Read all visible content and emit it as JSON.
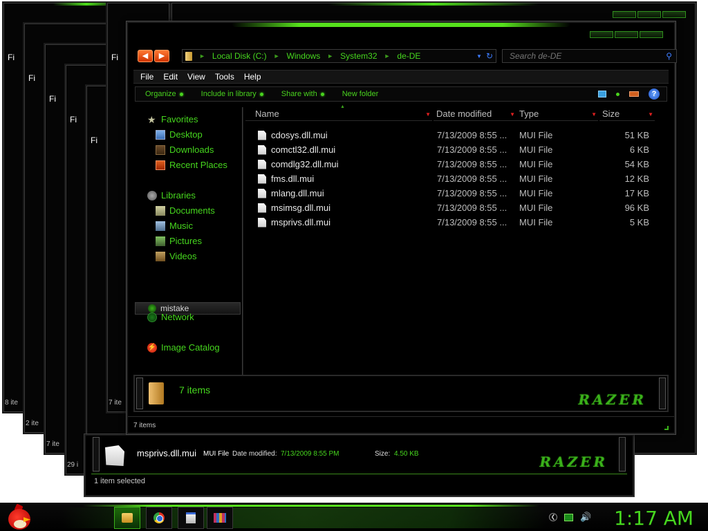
{
  "background_windows": [
    {
      "menu": "Fi",
      "count": "8 ite"
    },
    {
      "menu": "Fi",
      "count": "2 ite"
    },
    {
      "menu": "Fi",
      "count": "7 ite"
    },
    {
      "menu": "Fi",
      "count": "29 i"
    },
    {
      "menu": "Fi",
      "count": ""
    },
    {
      "menu": "Fi",
      "count": "7 ite"
    }
  ],
  "main_window": {
    "breadcrumb": [
      "Local Disk (C:)",
      "Windows",
      "System32",
      "de-DE"
    ],
    "search_placeholder": "Search de-DE",
    "menu": [
      "File",
      "Edit",
      "View",
      "Tools",
      "Help"
    ],
    "commands": [
      "Organize",
      "Include in library",
      "Share with",
      "New folder"
    ],
    "nav": {
      "favorites_label": "Favorites",
      "favorites": [
        "Desktop",
        "Downloads",
        "Recent Places"
      ],
      "libraries_label": "Libraries",
      "libraries": [
        "Documents",
        "Music",
        "Pictures",
        "Videos"
      ],
      "computer": "mistake",
      "network": "Network",
      "image_catalog": "Image Catalog"
    },
    "columns": [
      "Name",
      "Date modified",
      "Type",
      "Size"
    ],
    "files": [
      {
        "name": "cdosys.dll.mui",
        "date": "7/13/2009 8:55 ...",
        "type": "MUI File",
        "size": "51 KB"
      },
      {
        "name": "comctl32.dll.mui",
        "date": "7/13/2009 8:55 ...",
        "type": "MUI File",
        "size": "6 KB"
      },
      {
        "name": "comdlg32.dll.mui",
        "date": "7/13/2009 8:55 ...",
        "type": "MUI File",
        "size": "54 KB"
      },
      {
        "name": "fms.dll.mui",
        "date": "7/13/2009 8:55 ...",
        "type": "MUI File",
        "size": "12 KB"
      },
      {
        "name": "mlang.dll.mui",
        "date": "7/13/2009 8:55 ...",
        "type": "MUI File",
        "size": "17 KB"
      },
      {
        "name": "msimsg.dll.mui",
        "date": "7/13/2009 8:55 ...",
        "type": "MUI File",
        "size": "96 KB"
      },
      {
        "name": "msprivs.dll.mui",
        "date": "7/13/2009 8:55 ...",
        "type": "MUI File",
        "size": "5 KB"
      }
    ],
    "details_count": "7 items",
    "status": "7 items",
    "logo": "RAZER"
  },
  "selected_window": {
    "name": "msprivs.dll.mui",
    "type": "MUI File",
    "date_label": "Date modified:",
    "date_value": "7/13/2009 8:55 PM",
    "size_label": "Size:",
    "size_value": "4.50 KB",
    "status": "1 item selected",
    "logo": "RAZER"
  },
  "taskbar": {
    "apps": [
      "windows-explorer",
      "google-chrome",
      "notepad",
      "winrar"
    ],
    "clock": "1:17 AM"
  },
  "colors": {
    "accent_green": "#46d61e",
    "nav_orange": "#d03400",
    "background": "#000000"
  }
}
